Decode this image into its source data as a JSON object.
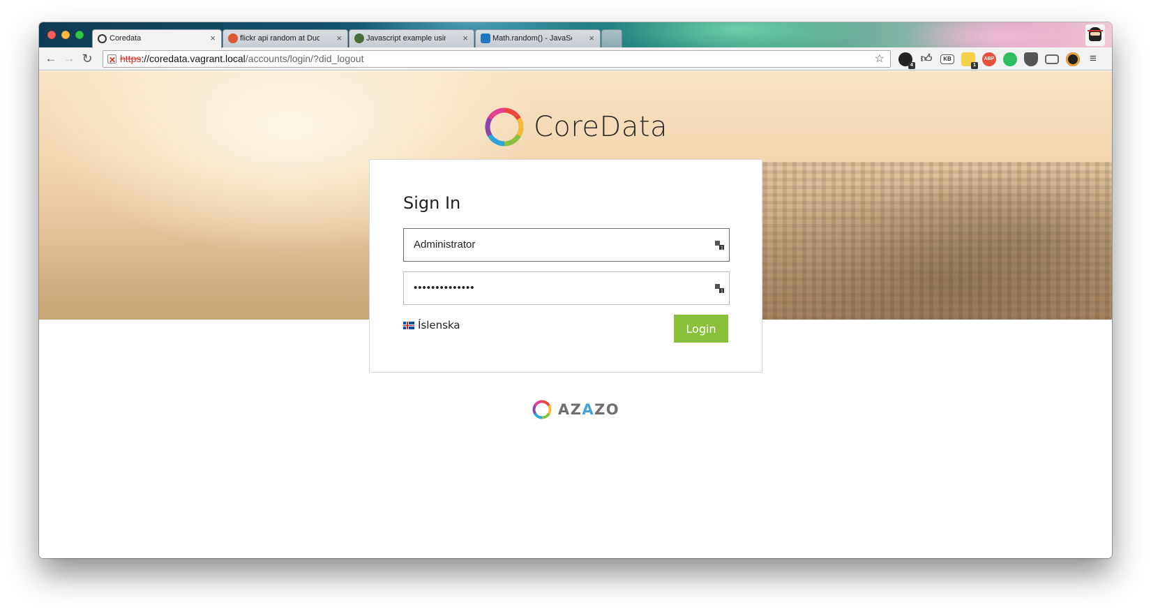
{
  "browser": {
    "tabs": [
      {
        "label": "Coredata",
        "favicon": "coredata-ring-icon",
        "active": true
      },
      {
        "label": "flickr api random at DuckD",
        "favicon": "duckduckgo-icon",
        "active": false
      },
      {
        "label": "Javascript example using",
        "favicon": "site-icon",
        "active": false
      },
      {
        "label": "Math.random() - JavaScrip",
        "favicon": "mdn-icon",
        "active": false
      }
    ],
    "tab_close_glyph": "×",
    "url": {
      "scheme": "https",
      "host": "://coredata.vagrant.local",
      "path": "/accounts/login/?did_logout"
    },
    "extensions": [
      {
        "name": "github-icon",
        "badge": "4"
      },
      {
        "name": "like-icon",
        "badge": ""
      },
      {
        "name": "keyboard-icon",
        "label": "KB",
        "badge": ""
      },
      {
        "name": "notes-icon",
        "badge": "1"
      },
      {
        "name": "adblock-icon",
        "label": "ABP",
        "badge": ""
      },
      {
        "name": "evernote-icon",
        "badge": ""
      },
      {
        "name": "pocket-icon",
        "badge": ""
      },
      {
        "name": "cast-icon",
        "badge": ""
      },
      {
        "name": "color-picker-icon",
        "badge": ""
      }
    ]
  },
  "page": {
    "brand_name": "CoreData",
    "sign_in_title": "Sign In",
    "username_value": "Administrator",
    "password_value": "••••••••••••••",
    "language_label": "Íslenska",
    "login_button_label": "Login",
    "footer_brand": {
      "main": "AZ",
      "accent": "A",
      "rest": "ZO"
    }
  },
  "colors": {
    "login_button": "#8bc03c",
    "logo_ring": [
      "#e8473a",
      "#f6b93b",
      "#8bc03c",
      "#2fa4d8",
      "#8e44ad",
      "#e23d8f"
    ]
  }
}
